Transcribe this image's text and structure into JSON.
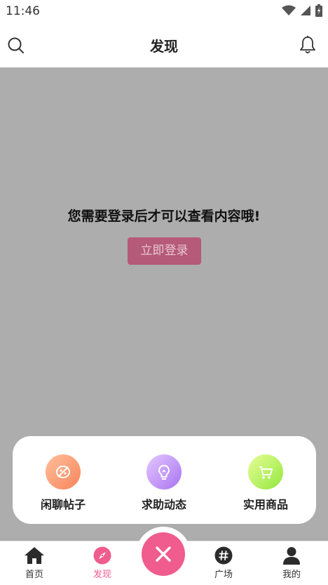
{
  "status_bar": {
    "time": "11:46",
    "icons": [
      "wifi-icon",
      "signal-icon",
      "battery-icon"
    ]
  },
  "header": {
    "title": "发现",
    "left_icon": "search-icon",
    "right_icon": "bell-icon"
  },
  "login_prompt": {
    "message": "您需要登录后才可以查看内容哦!",
    "button_label": "立即登录"
  },
  "popup_menu": {
    "items": [
      {
        "label": "闲聊帖子",
        "icon": "chat-post-icon"
      },
      {
        "label": "求助动态",
        "icon": "lightbulb-icon"
      },
      {
        "label": "实用商品",
        "icon": "cart-icon"
      }
    ]
  },
  "tabbar": {
    "tabs": [
      {
        "label": "首页",
        "icon": "home-icon",
        "active": false
      },
      {
        "label": "发现",
        "icon": "compass-icon",
        "active": true
      },
      {
        "label": "广场",
        "icon": "hashtag-icon",
        "active": false
      },
      {
        "label": "我的",
        "icon": "person-icon",
        "active": false
      }
    ],
    "center_button_icon": "close-icon"
  },
  "colors": {
    "accent": "#ef5c8d",
    "overlay": "#adadad",
    "login_button": "#b55a79"
  }
}
